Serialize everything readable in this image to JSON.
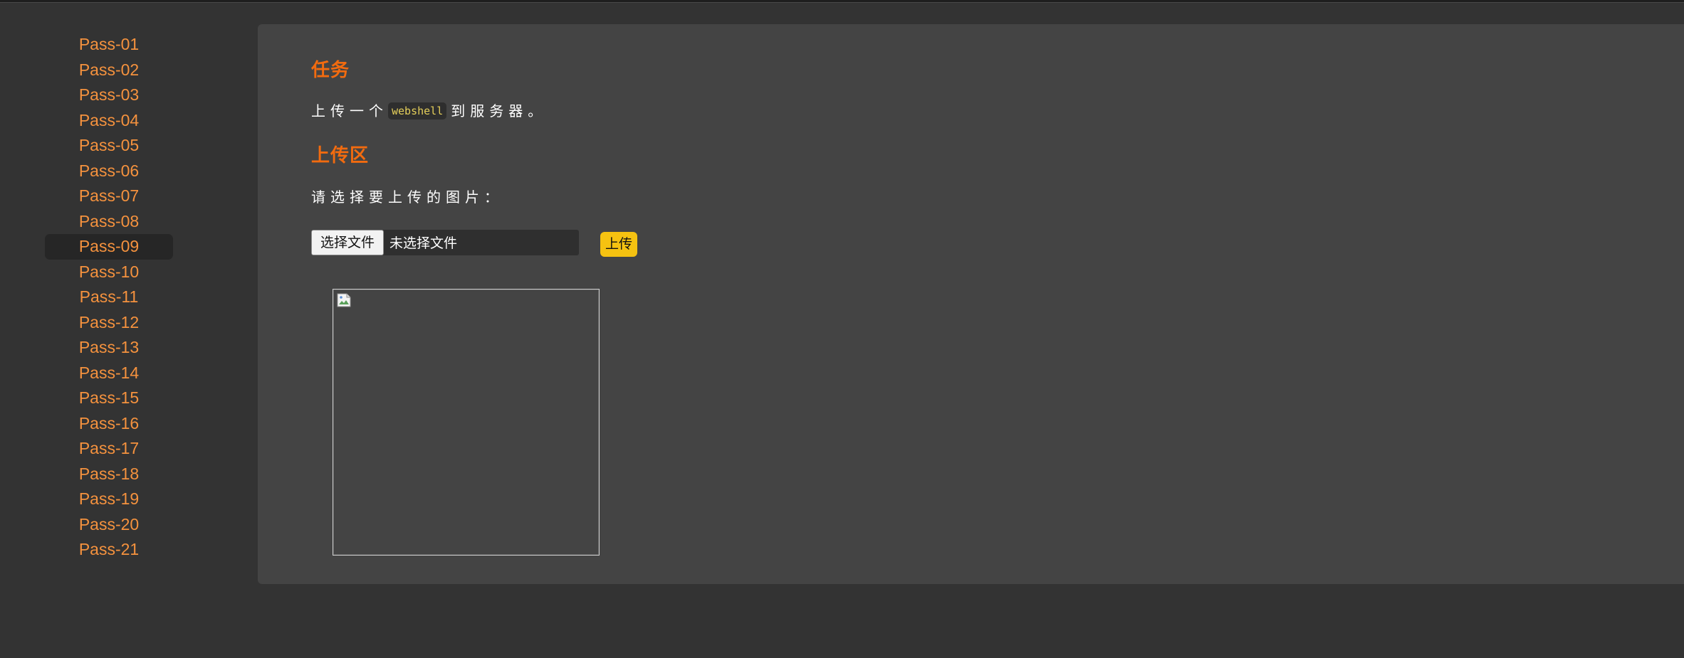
{
  "sidebar": {
    "items": [
      {
        "label": "Pass-01"
      },
      {
        "label": "Pass-02"
      },
      {
        "label": "Pass-03"
      },
      {
        "label": "Pass-04"
      },
      {
        "label": "Pass-05"
      },
      {
        "label": "Pass-06"
      },
      {
        "label": "Pass-07"
      },
      {
        "label": "Pass-08"
      },
      {
        "label": "Pass-09",
        "active": true
      },
      {
        "label": "Pass-10"
      },
      {
        "label": "Pass-11"
      },
      {
        "label": "Pass-12"
      },
      {
        "label": "Pass-13"
      },
      {
        "label": "Pass-14"
      },
      {
        "label": "Pass-15"
      },
      {
        "label": "Pass-16"
      },
      {
        "label": "Pass-17"
      },
      {
        "label": "Pass-18"
      },
      {
        "label": "Pass-19"
      },
      {
        "label": "Pass-20"
      },
      {
        "label": "Pass-21"
      }
    ]
  },
  "task": {
    "title": "任务",
    "text_before": "上传一个",
    "code": "webshell",
    "text_after": "到服务器。"
  },
  "upload": {
    "title": "上传区",
    "prompt": "请选择要上传的图片：",
    "choose_label": "选择文件",
    "no_file_label": "未选择文件",
    "submit_label": "上传"
  },
  "preview": {
    "icon": "broken-image-icon"
  },
  "colors": {
    "background": "#333333",
    "panel": "#444444",
    "nav_link": "#f5923e",
    "heading": "#f26b0f",
    "upload_button": "#f5c211",
    "code_text": "#e5cf5a"
  }
}
